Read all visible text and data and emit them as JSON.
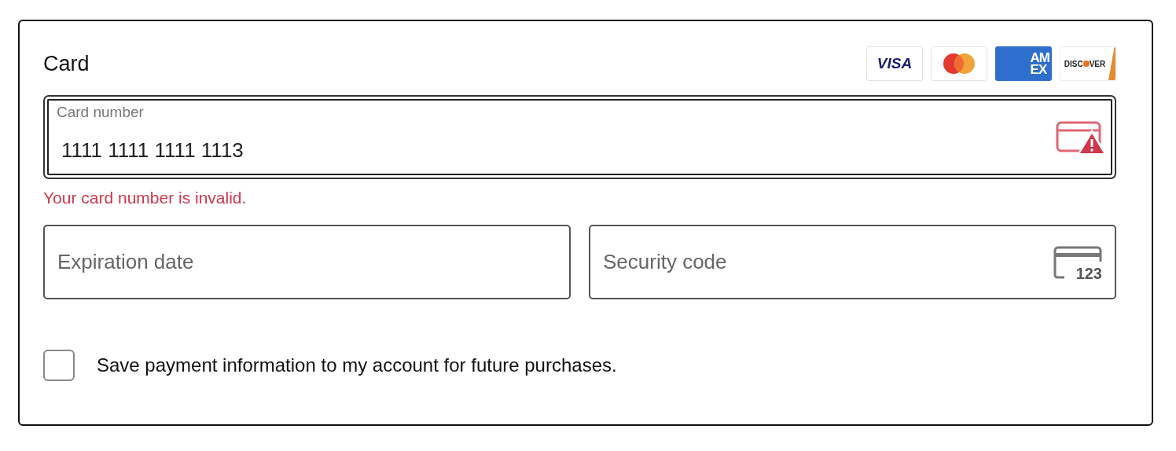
{
  "title": "Card",
  "brands": [
    {
      "kind": "visa",
      "texts": [
        "VISA"
      ]
    },
    {
      "kind": "mastercard"
    },
    {
      "kind": "amex",
      "texts": [
        "AM",
        "EX"
      ]
    },
    {
      "kind": "discover",
      "texts": [
        "DISC",
        "VER"
      ]
    }
  ],
  "card_number": {
    "label": "Card number",
    "value": "1111 1111 1111 1113",
    "focused": true,
    "invalid": true,
    "error": "Your card number is invalid."
  },
  "fields": [
    {
      "placeholder": "Expiration date",
      "kind": "plain"
    },
    {
      "placeholder": "Security code",
      "kind": "cvc",
      "icon_text": "123"
    }
  ],
  "save": {
    "label": "Save payment information to my account for future purchases.",
    "checked": false
  }
}
